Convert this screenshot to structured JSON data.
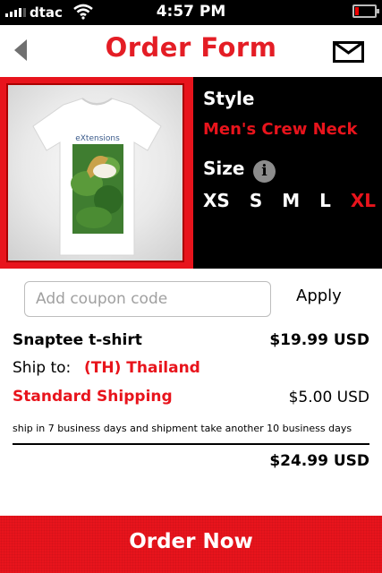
{
  "status_bar": {
    "carrier": "dtac",
    "time": "4:57 PM"
  },
  "nav": {
    "title": "Order Form"
  },
  "product": {
    "print_text": "eXtensions",
    "style_heading": "Style",
    "style_value": "Men's Crew Neck",
    "size_heading": "Size",
    "info_glyph": "i",
    "sizes": [
      "XS",
      "S",
      "M",
      "L",
      "XL"
    ],
    "selected_size": "XL"
  },
  "coupon": {
    "placeholder": "Add coupon code",
    "apply_label": "Apply"
  },
  "summary": {
    "item_name": "Snaptee t-shirt",
    "item_price": "$19.99 USD",
    "ship_to_label": "Ship to:",
    "ship_to_value": "(TH) Thailand",
    "shipping_method": "Standard Shipping",
    "shipping_price": "$5.00 USD",
    "shipping_note": "ship in 7 business days and shipment take another 10 business days",
    "total": "$24.99 USD"
  },
  "order_button_label": "Order Now",
  "colors": {
    "accent": "#e8141c",
    "title_red": "#e41d25",
    "panel_bg": "#000000"
  }
}
